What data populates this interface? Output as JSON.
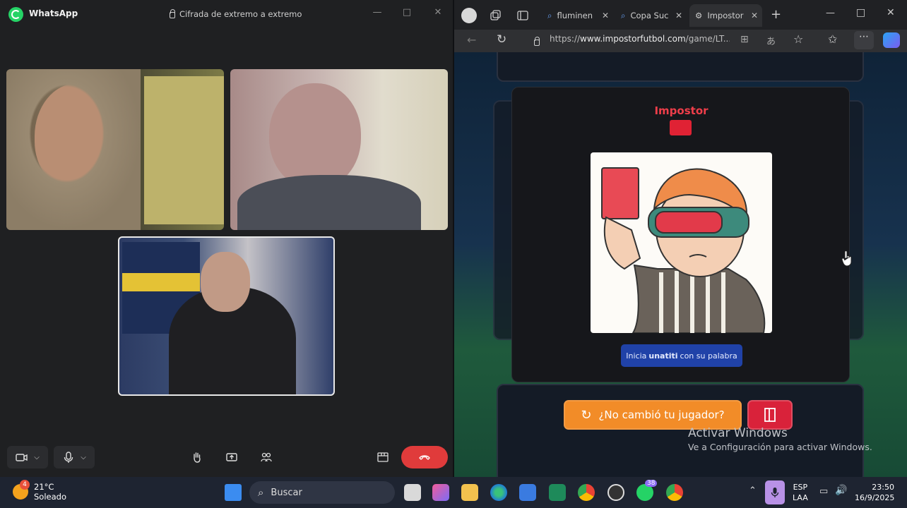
{
  "whatsapp": {
    "app_name": "WhatsApp",
    "encryption": "Cifrada de extremo a extremo"
  },
  "browser": {
    "tabs": [
      {
        "label": "fluminen",
        "icon": "search-icon"
      },
      {
        "label": "Copa Suc",
        "icon": "search-icon"
      },
      {
        "label": "Impostor",
        "icon": "gear-icon"
      }
    ],
    "url_prefix": "https://",
    "url_host": "www.impostorfutbol.com",
    "url_path": "/game/LT..."
  },
  "game": {
    "role_title": "Impostor",
    "starts_pre": "Inicia",
    "starts_name": "unatiti",
    "starts_post": "con su palabra",
    "changed_button": "¿No cambió tu jugador?",
    "role_color": "#e02234"
  },
  "windows_activation": {
    "title": "Activar Windows",
    "subtitle": "Ve a Configuración para activar Windows."
  },
  "taskbar": {
    "temperature": "21°C",
    "condition": "Soleado",
    "weather_badge": "4",
    "search_placeholder": "Buscar",
    "whatsapp_badge": "38",
    "lang_top": "ESP",
    "lang_bottom": "LAA",
    "time": "23:50",
    "date": "16/9/2025"
  }
}
